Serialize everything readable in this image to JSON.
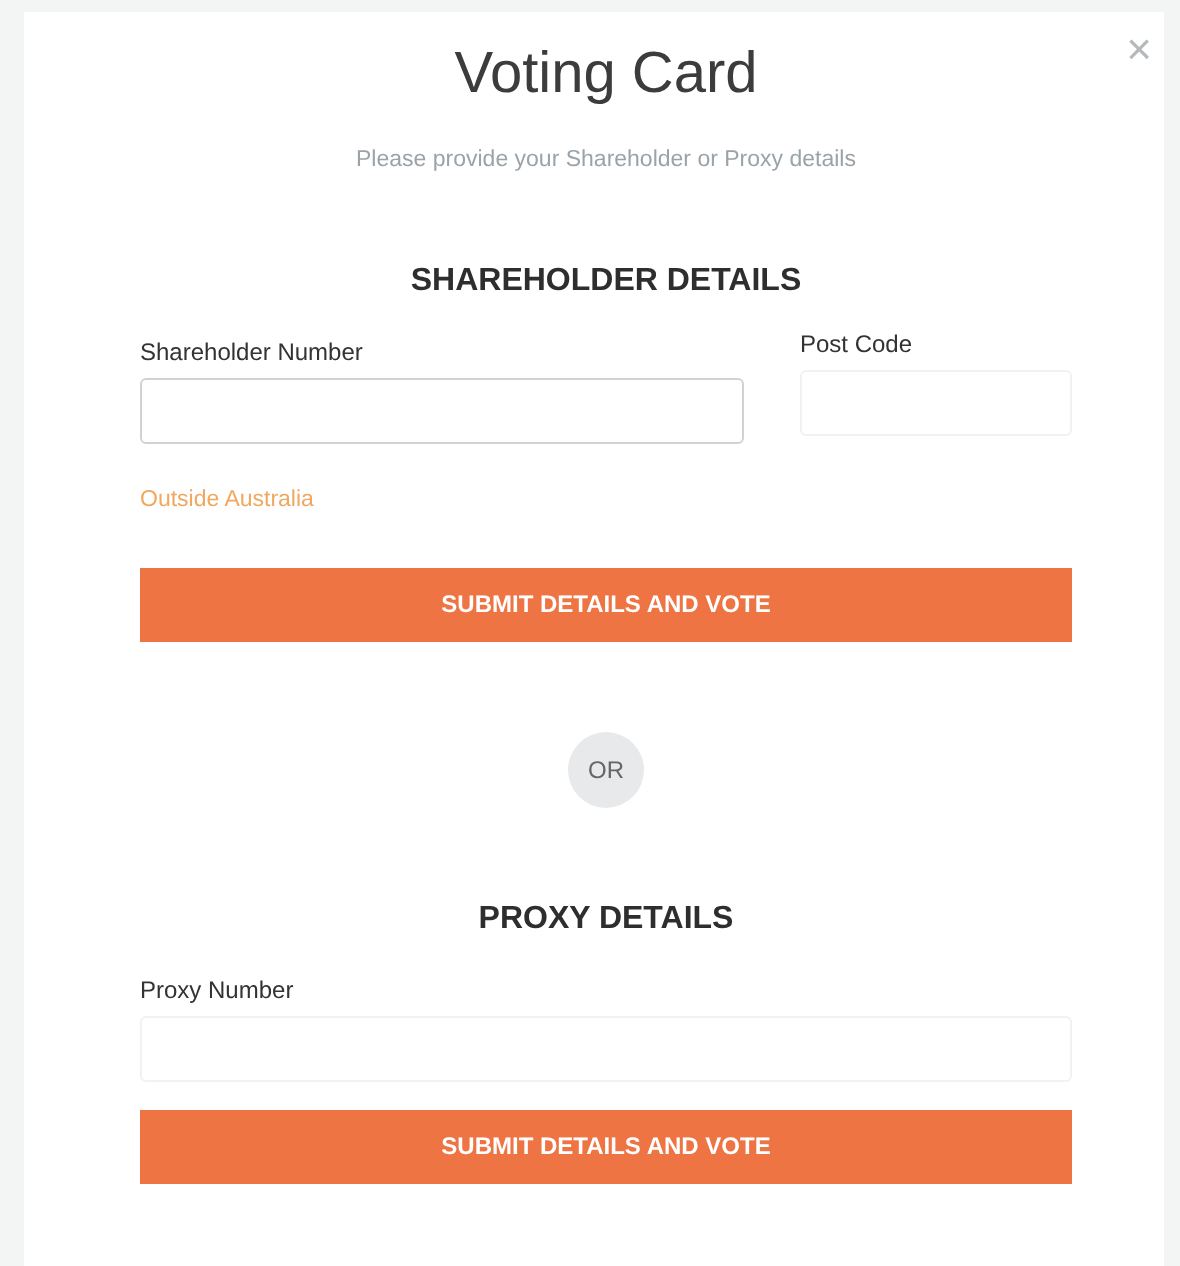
{
  "dialog": {
    "title": "Voting Card",
    "subtitle": "Please provide your Shareholder or Proxy details",
    "close": "×"
  },
  "shareholder": {
    "heading": "SHAREHOLDER DETAILS",
    "fields": [
      {
        "label": "Shareholder Number",
        "kind": "wide"
      },
      {
        "label": "Post Code",
        "kind": "narrow"
      }
    ],
    "link": "Outside Australia",
    "button": "SUBMIT DETAILS AND VOTE"
  },
  "separator": "OR",
  "proxy": {
    "heading": "PROXY DETAILS",
    "fields": [
      {
        "label": "Proxy Number",
        "kind": "full"
      }
    ],
    "button": "SUBMIT DETAILS AND VOTE"
  }
}
